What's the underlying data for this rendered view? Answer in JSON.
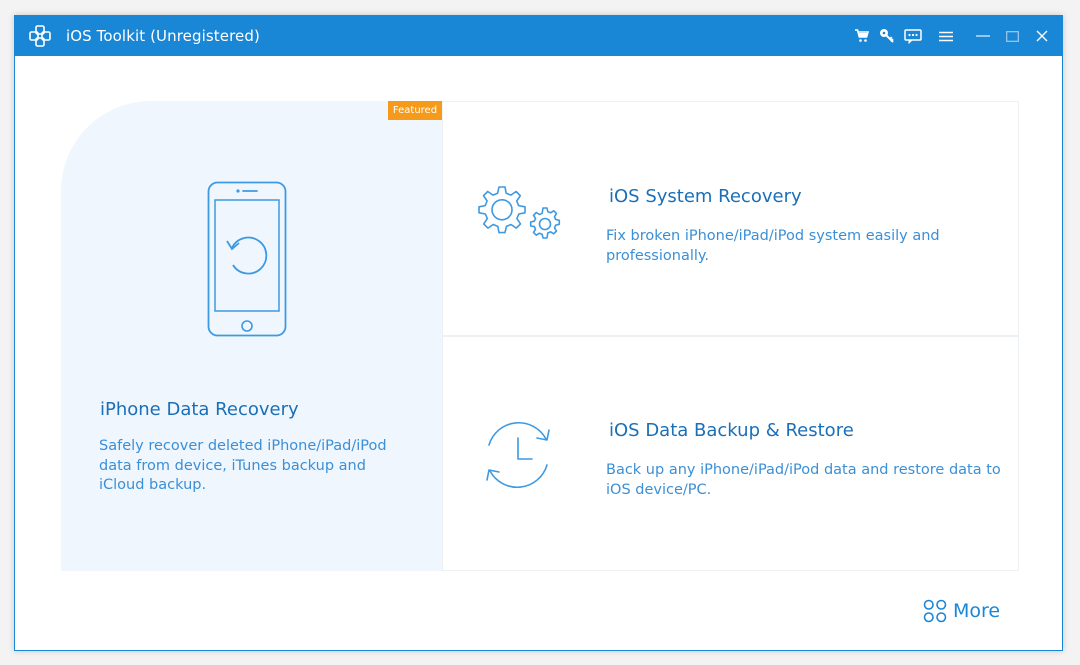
{
  "window": {
    "title": "iOS Toolkit (Unregistered)",
    "accent_color": "#1a86d6"
  },
  "titlebar_icons": [
    "cart-icon",
    "key-icon",
    "feedback-icon",
    "menu-icon",
    "minimize-icon",
    "maximize-icon",
    "close-icon"
  ],
  "main_card": {
    "badge": "Featured",
    "title": "iPhone Data Recovery",
    "description_lines": [
      "Safely recover deleted iPhone/iPad/iPod",
      "data from device, iTunes backup and",
      "iCloud backup."
    ],
    "icon": "phone-recovery-icon"
  },
  "system_recovery": {
    "title": "iOS System Recovery",
    "description_lines": [
      "Fix broken iPhone/iPad/iPod system easily and",
      "professionally."
    ],
    "icon": "gears-icon"
  },
  "backup_restore": {
    "title": "iOS Data Backup & Restore",
    "description_lines": [
      "Back up any iPhone/iPad/iPod data and restore data to",
      "iOS device/PC."
    ],
    "icon": "clock-sync-icon"
  },
  "more": {
    "label": "More",
    "icon": "grid-icon"
  }
}
